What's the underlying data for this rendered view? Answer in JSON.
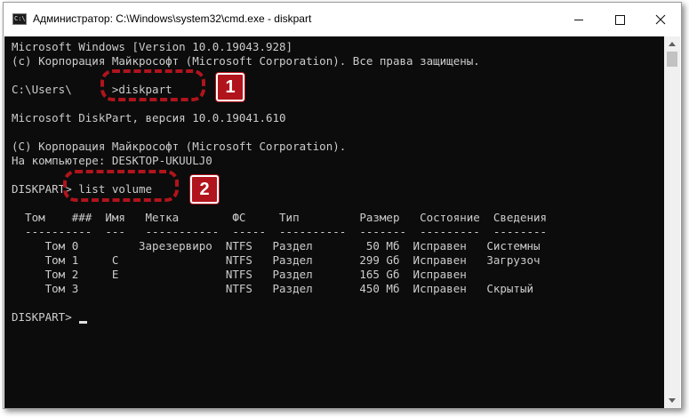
{
  "window": {
    "title": "Администратор: C:\\Windows\\system32\\cmd.exe - diskpart",
    "icon_label": "C:\\",
    "icon": "cmd-icon",
    "controls": [
      "minimize-icon",
      "maximize-icon",
      "close-icon"
    ]
  },
  "console": {
    "background": "#0c0c0c",
    "foreground": "#cccccc",
    "lines": [
      "Microsoft Windows [Version 10.0.19043.928]",
      "(c) Корпорация Майкрософт (Microsoft Corporation). Все права защищены.",
      "",
      "C:\\Users\\      >diskpart",
      "",
      "Microsoft DiskPart, версия 10.0.19041.610",
      "",
      "(C) Корпорация Майкрософт (Microsoft Corporation).",
      "На компьютере: DESKTOP-UKUULJ0",
      "",
      "DISKPART> list volume",
      "",
      "  Том    ###  Имя   Метка        ФС     Тип         Размер   Состояние  Сведения",
      "  ----------  ---   -----------  -----  ----------  -------  ---------  --------",
      "     Том 0         Зарезервиро  NTFS   Раздел        50 Мб  Исправен   Системны",
      "     Том 1     C                NTFS   Раздел       299 Gб  Исправен   Загрузоч",
      "     Том 2     E                NTFS   Раздел       165 Gб  Исправен",
      "     Том 3                      NTFS   Раздел       450 Мб  Исправен   Скрытый",
      "",
      "DISKPART> "
    ]
  },
  "annotations": {
    "accent": "#b1141c",
    "step1": "1",
    "step2": "2"
  },
  "scrollbar": {
    "up_icon": "scroll-up-arrow-icon",
    "down_icon": "scroll-down-arrow-icon"
  }
}
